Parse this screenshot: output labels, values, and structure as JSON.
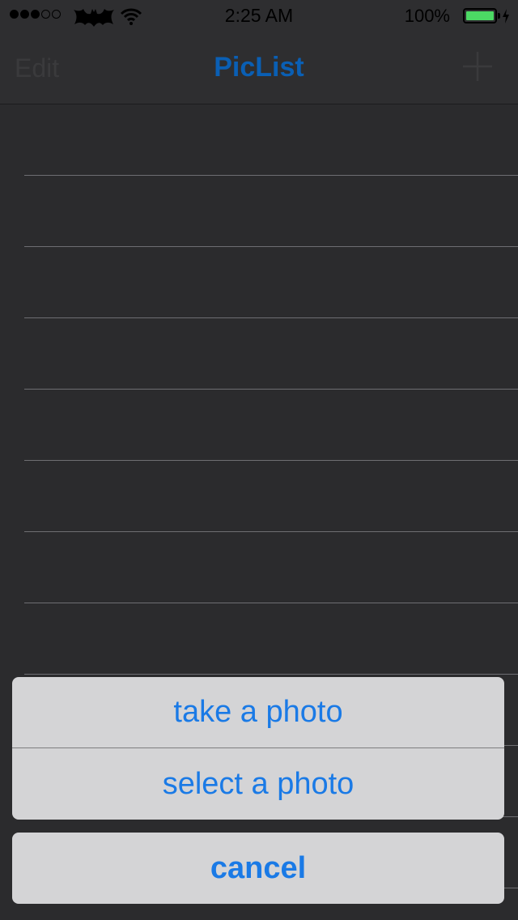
{
  "status_bar": {
    "time": "2:25 AM",
    "battery_percent": "100%",
    "signal_bars_filled": 3,
    "signal_bars_total": 5,
    "carrier_icon": "bat-logo-icon",
    "wifi_icon": "wifi-icon",
    "battery_level": 1.0,
    "charging": true
  },
  "nav_bar": {
    "left_label": "Edit",
    "title": "PicList",
    "right_icon": "plus-icon"
  },
  "table": {
    "row_count": 11
  },
  "action_sheet": {
    "options": [
      "take a photo",
      "select a photo"
    ],
    "cancel_label": "cancel"
  },
  "colors": {
    "background": "#2b2b2d",
    "accent": "#1a7ae6",
    "title": "#0a5fb4",
    "sheet_background": "#d4d4d6",
    "battery": "#4cd964"
  }
}
